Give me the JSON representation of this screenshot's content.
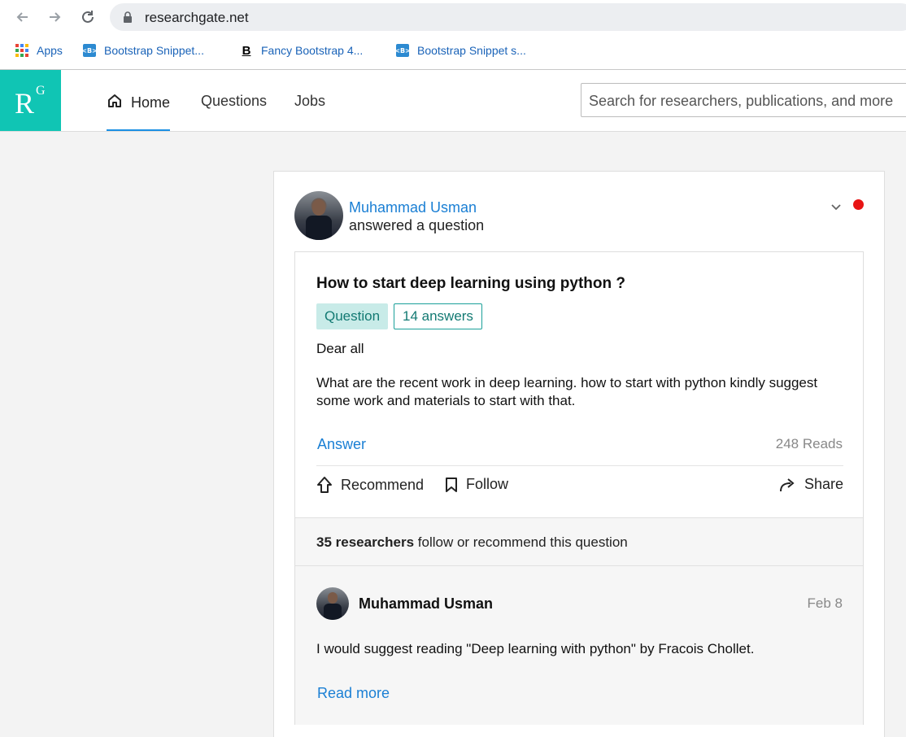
{
  "browser": {
    "url": "researchgate.net",
    "bookmarks": [
      {
        "label": "Apps",
        "icon": "apps-grid-icon"
      },
      {
        "label": "Bootstrap Snippet...",
        "icon": "bootstrap-icon"
      },
      {
        "label": "Fancy Bootstrap 4...",
        "icon": "bold-b-icon"
      },
      {
        "label": "Bootstrap Snippet s...",
        "icon": "bootstrap-icon"
      }
    ]
  },
  "header": {
    "logo_r": "R",
    "logo_g": "G",
    "nav": [
      "Home",
      "Questions",
      "Jobs"
    ],
    "search_placeholder": "Search for researchers, publications, and more"
  },
  "post": {
    "author": "Muhammad Usman",
    "action": "answered a question",
    "question_title": "How to start deep learning using python ?",
    "tag_question": "Question",
    "tag_answers": "14 answers",
    "body_1": "Dear all",
    "body_2": "What are the recent work in deep learning. how to start with python kindly suggest some work and materials to start with that.",
    "answer_link": "Answer",
    "reads": "248 Reads",
    "actions": {
      "recommend": "Recommend",
      "follow": "Follow",
      "share": "Share"
    },
    "followers_bold": "35 researchers",
    "followers_rest": " follow or recommend this question",
    "answer": {
      "author": "Muhammad Usman",
      "date": "Feb 8",
      "text": "I would suggest reading \"Deep learning with python\" by Fracois Chollet.",
      "read_more": "Read more"
    }
  },
  "colors": {
    "brand": "#10c5b4",
    "link": "#1a7fd4",
    "notification": "#e81414",
    "tag_bg": "#c8ebe8"
  }
}
